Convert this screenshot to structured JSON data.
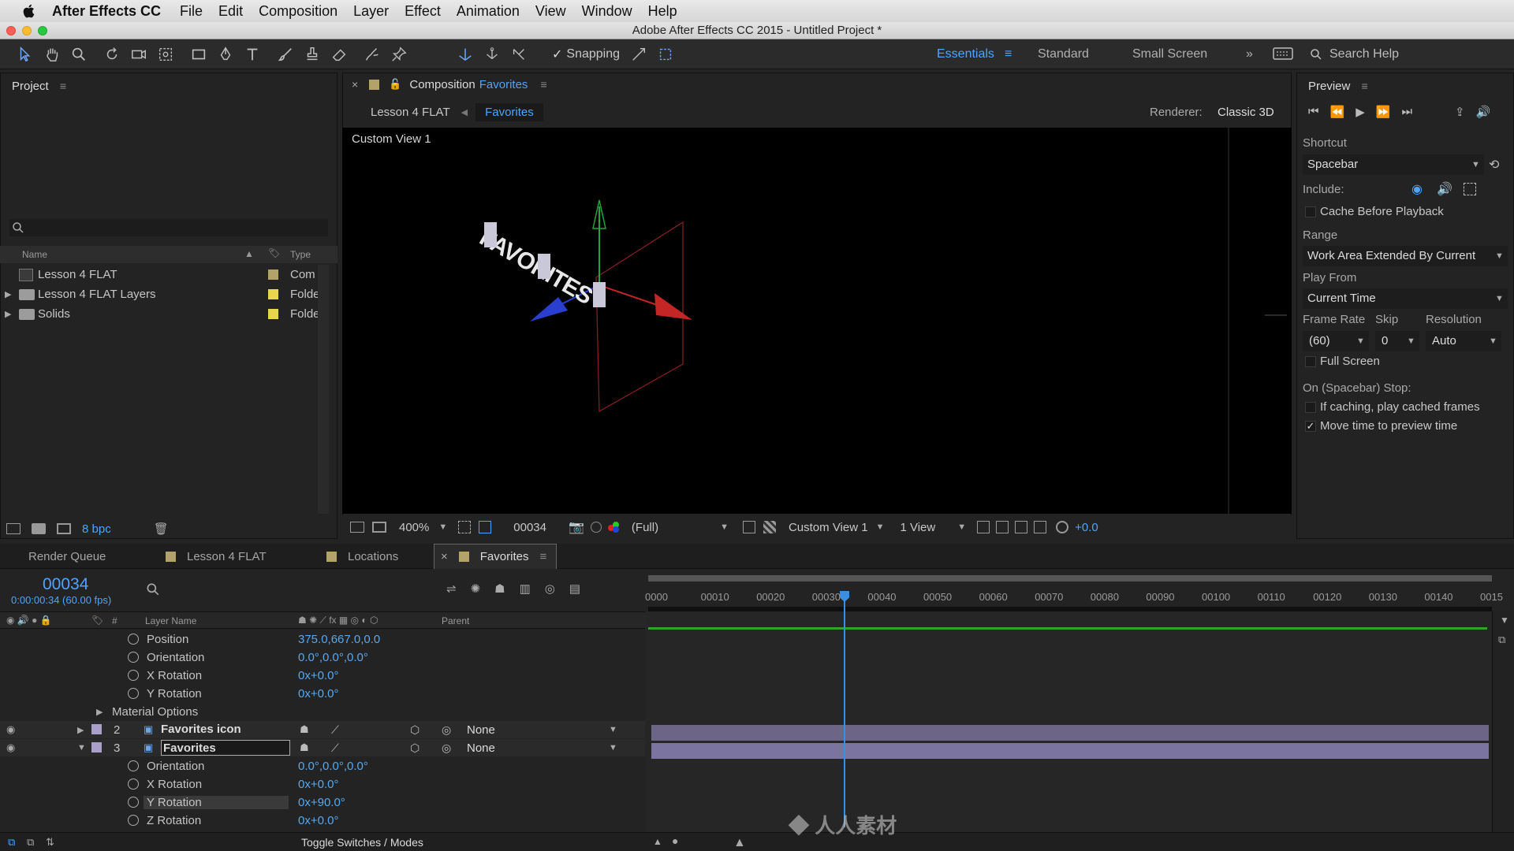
{
  "menubar": {
    "app_name": "After Effects CC",
    "items": [
      "File",
      "Edit",
      "Composition",
      "Layer",
      "Effect",
      "Animation",
      "View",
      "Window",
      "Help"
    ]
  },
  "window": {
    "title": "Adobe After Effects CC 2015 - Untitled Project *"
  },
  "toolbar": {
    "snapping_label": "Snapping",
    "workspaces": [
      "Essentials",
      "Standard",
      "Small Screen"
    ],
    "search_placeholder": "Search Help"
  },
  "project": {
    "title": "Project",
    "columns": {
      "name": "Name",
      "type": "Type"
    },
    "items": [
      {
        "name": "Lesson 4 FLAT",
        "type": "Com",
        "label_color": "#b3a36a"
      },
      {
        "name": "Lesson 4 FLAT Layers",
        "type": "Folde",
        "label_color": "#e8d64e"
      },
      {
        "name": "Solids",
        "type": "Folde",
        "label_color": "#e8d64e"
      }
    ],
    "bpc": "8 bpc"
  },
  "composition": {
    "panel_title": "Composition",
    "comp_name": "Favorites",
    "breadcrumbs": [
      "Lesson 4 FLAT",
      "Favorites"
    ],
    "renderer_label": "Renderer:",
    "renderer_value": "Classic 3D",
    "view_label": "Custom View 1",
    "viewer_text": "FAVORITES",
    "footer": {
      "zoom": "400%",
      "timecode": "00034",
      "resolution": "(Full)",
      "view": "Custom View 1",
      "views_count": "1 View",
      "exposure": "+0.0"
    }
  },
  "preview": {
    "title": "Preview",
    "shortcut_label": "Shortcut",
    "shortcut_value": "Spacebar",
    "include_label": "Include:",
    "cache_label": "Cache Before Playback",
    "cache_checked": false,
    "range_label": "Range",
    "range_value": "Work Area Extended By Current",
    "play_from_label": "Play From",
    "play_from_value": "Current Time",
    "frame_rate_label": "Frame Rate",
    "skip_label": "Skip",
    "resolution_label": "Resolution",
    "frame_rate_value": "(60)",
    "skip_value": "0",
    "resolution_value": "Auto",
    "full_screen_label": "Full Screen",
    "full_screen_checked": false,
    "stop_label": "On (Spacebar) Stop:",
    "if_caching_label": "If caching, play cached frames",
    "if_caching_checked": false,
    "move_time_label": "Move time to preview time",
    "move_time_checked": true
  },
  "timeline_tabs": [
    {
      "label": "Render Queue",
      "color": ""
    },
    {
      "label": "Lesson 4 FLAT",
      "color": "#b3a36a"
    },
    {
      "label": "Locations",
      "color": "#b3a36a"
    },
    {
      "label": "Favorites",
      "color": "#b3a36a",
      "active": true
    }
  ],
  "timeline": {
    "timecode": "00034",
    "timecode_sub": "0:00:00:34 (60.00 fps)",
    "col_layer_name": "Layer Name",
    "col_parent": "Parent",
    "ruler_labels": [
      "0000",
      "00010",
      "00020",
      "00030",
      "00040",
      "00050",
      "00060",
      "00070",
      "00080",
      "00090",
      "00100",
      "00110",
      "00120",
      "00130",
      "00140",
      "0015"
    ],
    "current_frame": 34,
    "total_frames": 150,
    "rows": [
      {
        "kind": "prop",
        "name": "Position",
        "value": "375.0,667.0,0.0"
      },
      {
        "kind": "prop",
        "name": "Orientation",
        "value": "0.0°,0.0°,0.0°"
      },
      {
        "kind": "prop",
        "name": "X Rotation",
        "value": "0x+0.0°"
      },
      {
        "kind": "prop",
        "name": "Y Rotation",
        "value": "0x+0.0°"
      },
      {
        "kind": "group",
        "name": "Material Options"
      },
      {
        "kind": "layer",
        "num": "2",
        "name": "Favorites icon",
        "parent": "None"
      },
      {
        "kind": "layer",
        "num": "3",
        "name": "Favorites",
        "parent": "None",
        "selected": true
      },
      {
        "kind": "prop",
        "name": "Orientation",
        "value": "0.0°,0.0°,0.0°"
      },
      {
        "kind": "prop",
        "name": "X Rotation",
        "value": "0x+0.0°"
      },
      {
        "kind": "prop",
        "name": "Y Rotation",
        "value": "0x+90.0°",
        "highlight": true
      },
      {
        "kind": "prop",
        "name": "Z Rotation",
        "value": "0x+0.0°"
      }
    ],
    "toggle_label": "Toggle Switches / Modes"
  }
}
